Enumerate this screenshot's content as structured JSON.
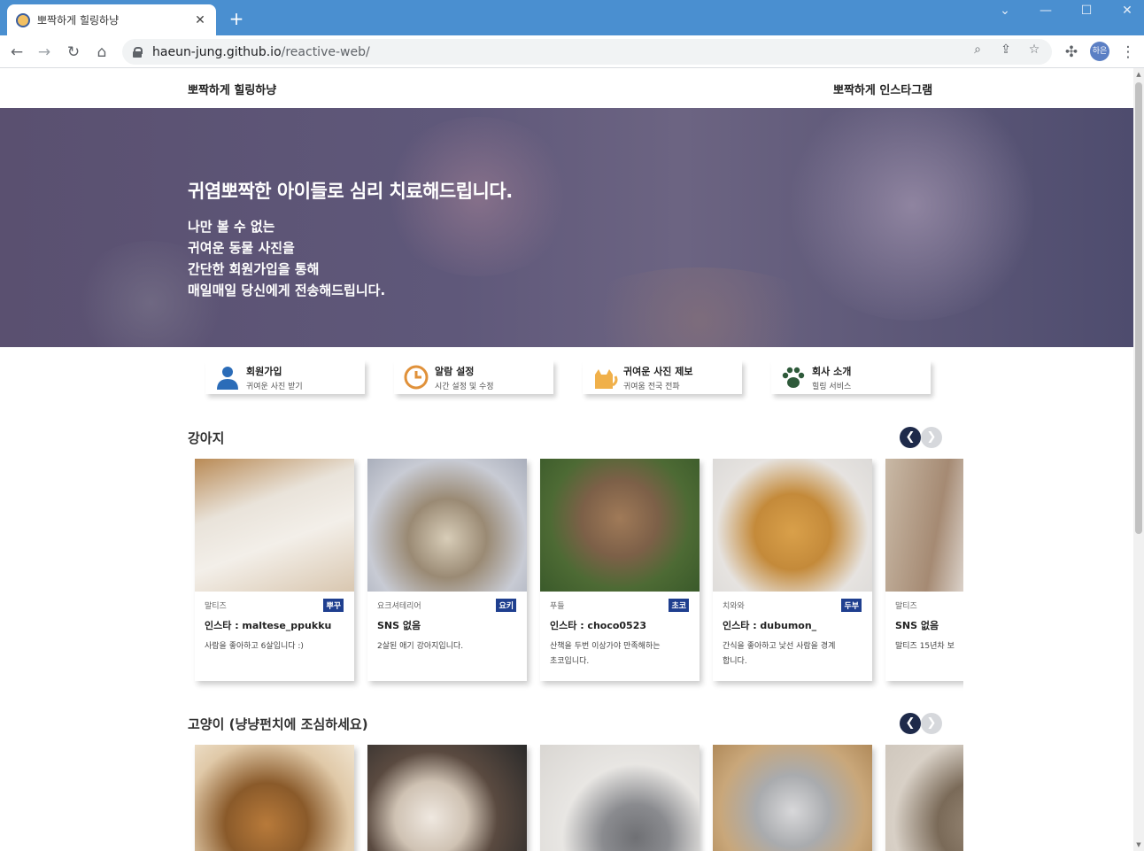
{
  "browser": {
    "tab_title": "뽀짝하게 힐링하냥",
    "tab_close": "✕",
    "new_tab": "+",
    "url_host": "haeun-jung.github.io",
    "url_path": "/reactive-web/",
    "profile_label": "하은"
  },
  "header": {
    "brand": "뽀짝하게 힐링하냥",
    "insta_link": "뽀짝하게 인스타그램"
  },
  "hero": {
    "title": "귀염뽀짝한 아이들로 심리 치료해드립니다.",
    "lines": [
      "나만 볼 수 없는",
      "귀여운 동물 사진을",
      "간단한 회원가입을 통해",
      "매일매일 당신에게 전송해드립니다."
    ]
  },
  "features": [
    {
      "title": "회원가입",
      "sub": "귀여운 사진 받기",
      "icon": "user-icon",
      "color": "#2b6cb8"
    },
    {
      "title": "알람 설정",
      "sub": "시간 설정 및 수정",
      "icon": "clock-icon",
      "color": "#e0913a"
    },
    {
      "title": "귀여운 사진 제보",
      "sub": "귀여움 전국 전파",
      "icon": "cat-icon",
      "color": "#f0b04a"
    },
    {
      "title": "회사 소개",
      "sub": "힐링 서비스",
      "icon": "paw-icon",
      "color": "#2e5a3a"
    }
  ],
  "sections": {
    "dogs": {
      "title": "강아지",
      "cards": [
        {
          "breed": "말티즈",
          "badge": "뿌꾸",
          "handle": "인스타 : maltese_ppukku",
          "desc": [
            "사람을 좋아하고 6살입니다 :)"
          ]
        },
        {
          "breed": "요크셔테리어",
          "badge": "요키",
          "handle": "SNS 없음",
          "desc": [
            "2살된 애기 강아지입니다."
          ]
        },
        {
          "breed": "푸들",
          "badge": "초코",
          "handle": "인스타 : choco0523",
          "desc": [
            "산책을 두번 이상가야 만족해하는",
            "초코입니다."
          ]
        },
        {
          "breed": "치와와",
          "badge": "두부",
          "handle": "인스타 : dubumon_",
          "desc": [
            "간식을 좋아하고 낯선 사람을 경계",
            "합니다."
          ]
        },
        {
          "breed": "말티즈",
          "badge": "",
          "handle": "SNS 없음",
          "desc": [
            "말티즈 15년차 보"
          ]
        }
      ]
    },
    "cats": {
      "title": "고양이 (냥냥펀치에 조심하세요)"
    }
  },
  "pager": {
    "prev": "❮",
    "next": "❯"
  }
}
